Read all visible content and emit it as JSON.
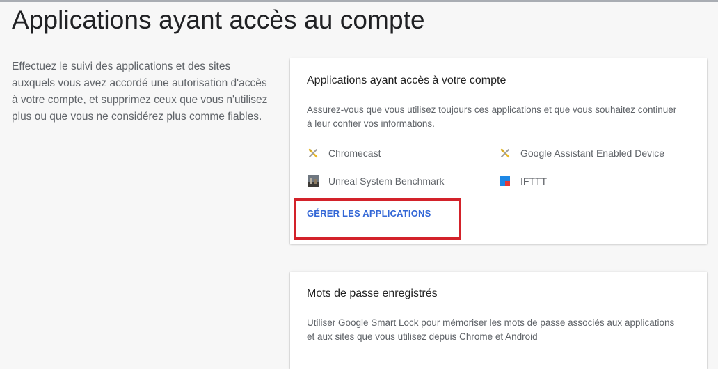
{
  "page": {
    "title": "Applications ayant accès au compte",
    "intro": "Effectuez le suivi des applications et des sites auxquels vous avez accordé une autorisation d'accès à votre compte, et supprimez ceux que vous n'utilisez plus ou que vous ne considérez plus comme fiables."
  },
  "apps_card": {
    "title": "Applications ayant accès à votre compte",
    "description": "Assurez-vous que vous utilisez toujours ces applications et que vous souhaitez continuer à leur confier vos informations.",
    "apps": [
      {
        "name": "Chromecast",
        "icon": "tools-icon"
      },
      {
        "name": "Google Assistant Enabled Device",
        "icon": "tools-icon"
      },
      {
        "name": "Unreal System Benchmark",
        "icon": "benchmark-app-icon"
      },
      {
        "name": "IFTTT",
        "icon": "ifttt-app-icon"
      }
    ],
    "manage_label": "GÉRER LES APPLICATIONS"
  },
  "passwords_card": {
    "title": "Mots de passe enregistrés",
    "description": "Utiliser Google Smart Lock pour mémoriser les mots de passe associés aux applications et aux sites que vous utilisez depuis Chrome et Android"
  },
  "colors": {
    "link": "#3367d6",
    "highlight": "#d3222a",
    "background": "#f7f7f7"
  }
}
